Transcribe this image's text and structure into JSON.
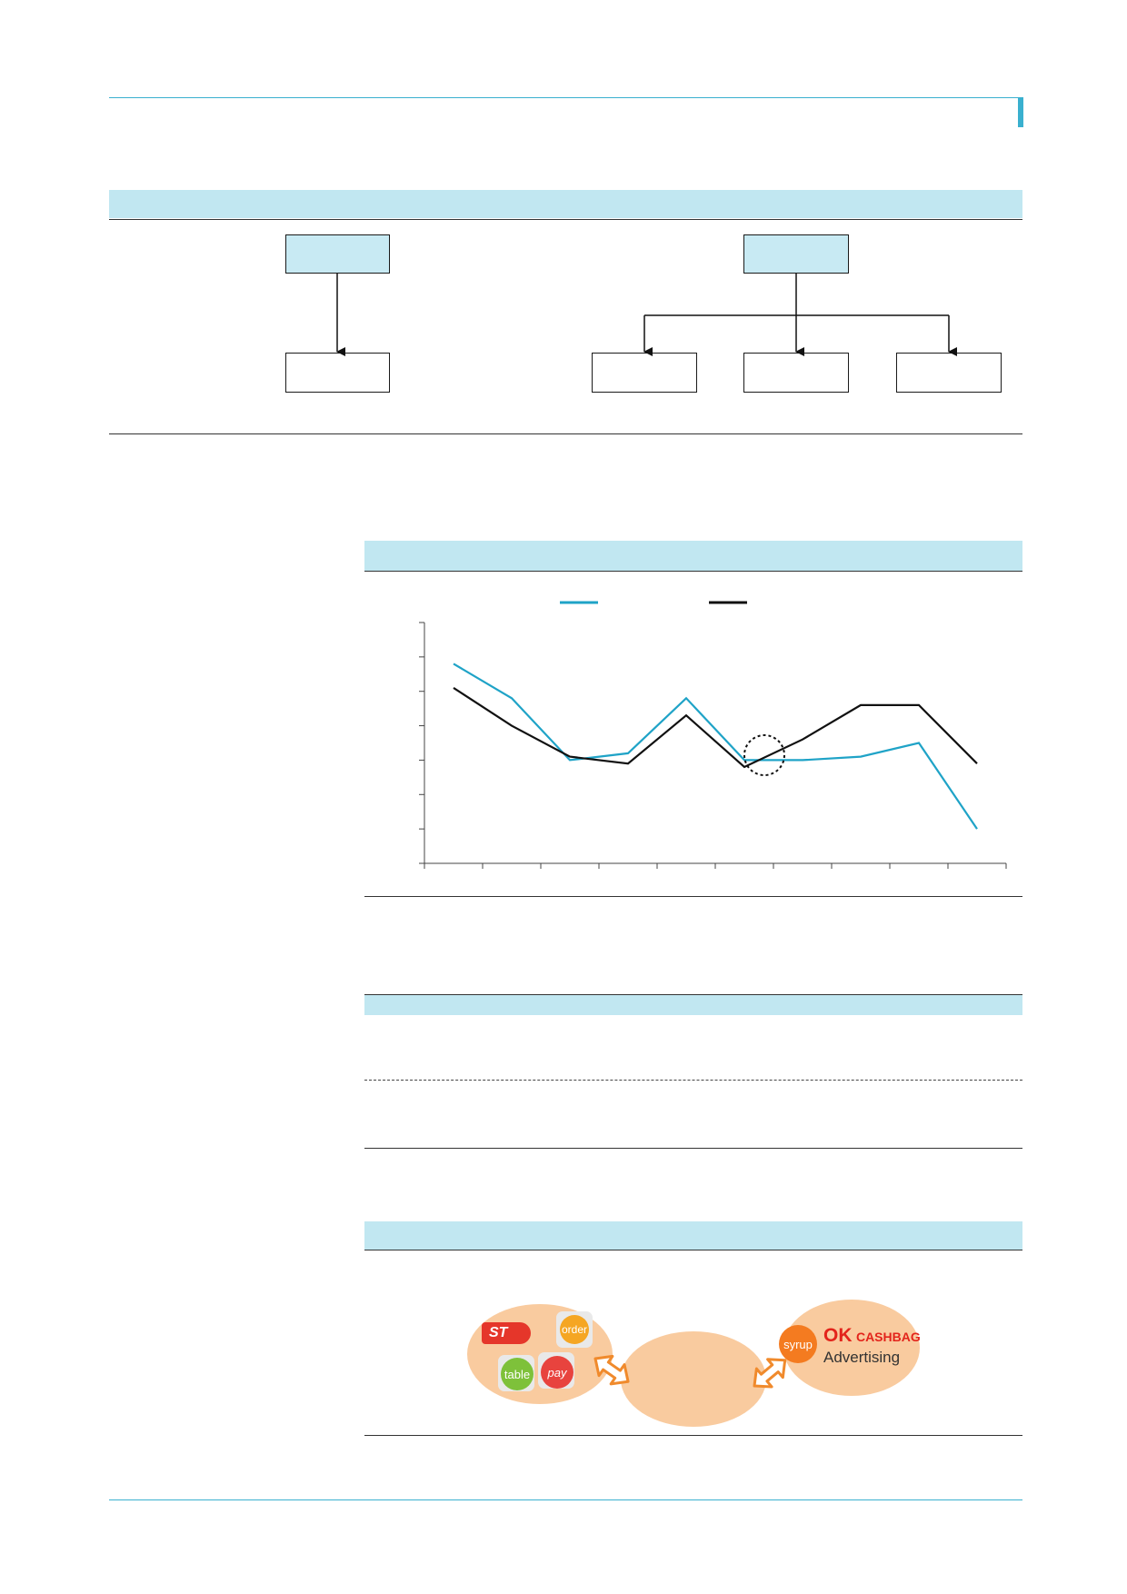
{
  "colors": {
    "accent": "#3ab0cf",
    "panel_header": "#c1e7f1",
    "line_series_1": "#1fa3c7",
    "line_series_2": "#111111",
    "ellipse_fill": "#f9cb9f",
    "arrow_orange": "#f08a2c"
  },
  "logos": {
    "eleven_st": "ST",
    "order": "order",
    "table": "table",
    "pay": "pay",
    "syrup": "syrup",
    "ok_cashbag_ok": "OK",
    "ok_cashbag_text": "CASHBAG",
    "advertising": "Advertising"
  },
  "chart_data": {
    "type": "line",
    "x_count": 10,
    "ylim": [
      0,
      7
    ],
    "series": [
      {
        "values": [
          5.8,
          4.8,
          3.0,
          3.2,
          4.8,
          3.0,
          3.0,
          3.1,
          3.5,
          1.0
        ]
      },
      {
        "values": [
          5.1,
          4.0,
          3.1,
          2.9,
          4.3,
          2.8,
          3.6,
          4.6,
          4.6,
          2.9
        ]
      }
    ]
  }
}
